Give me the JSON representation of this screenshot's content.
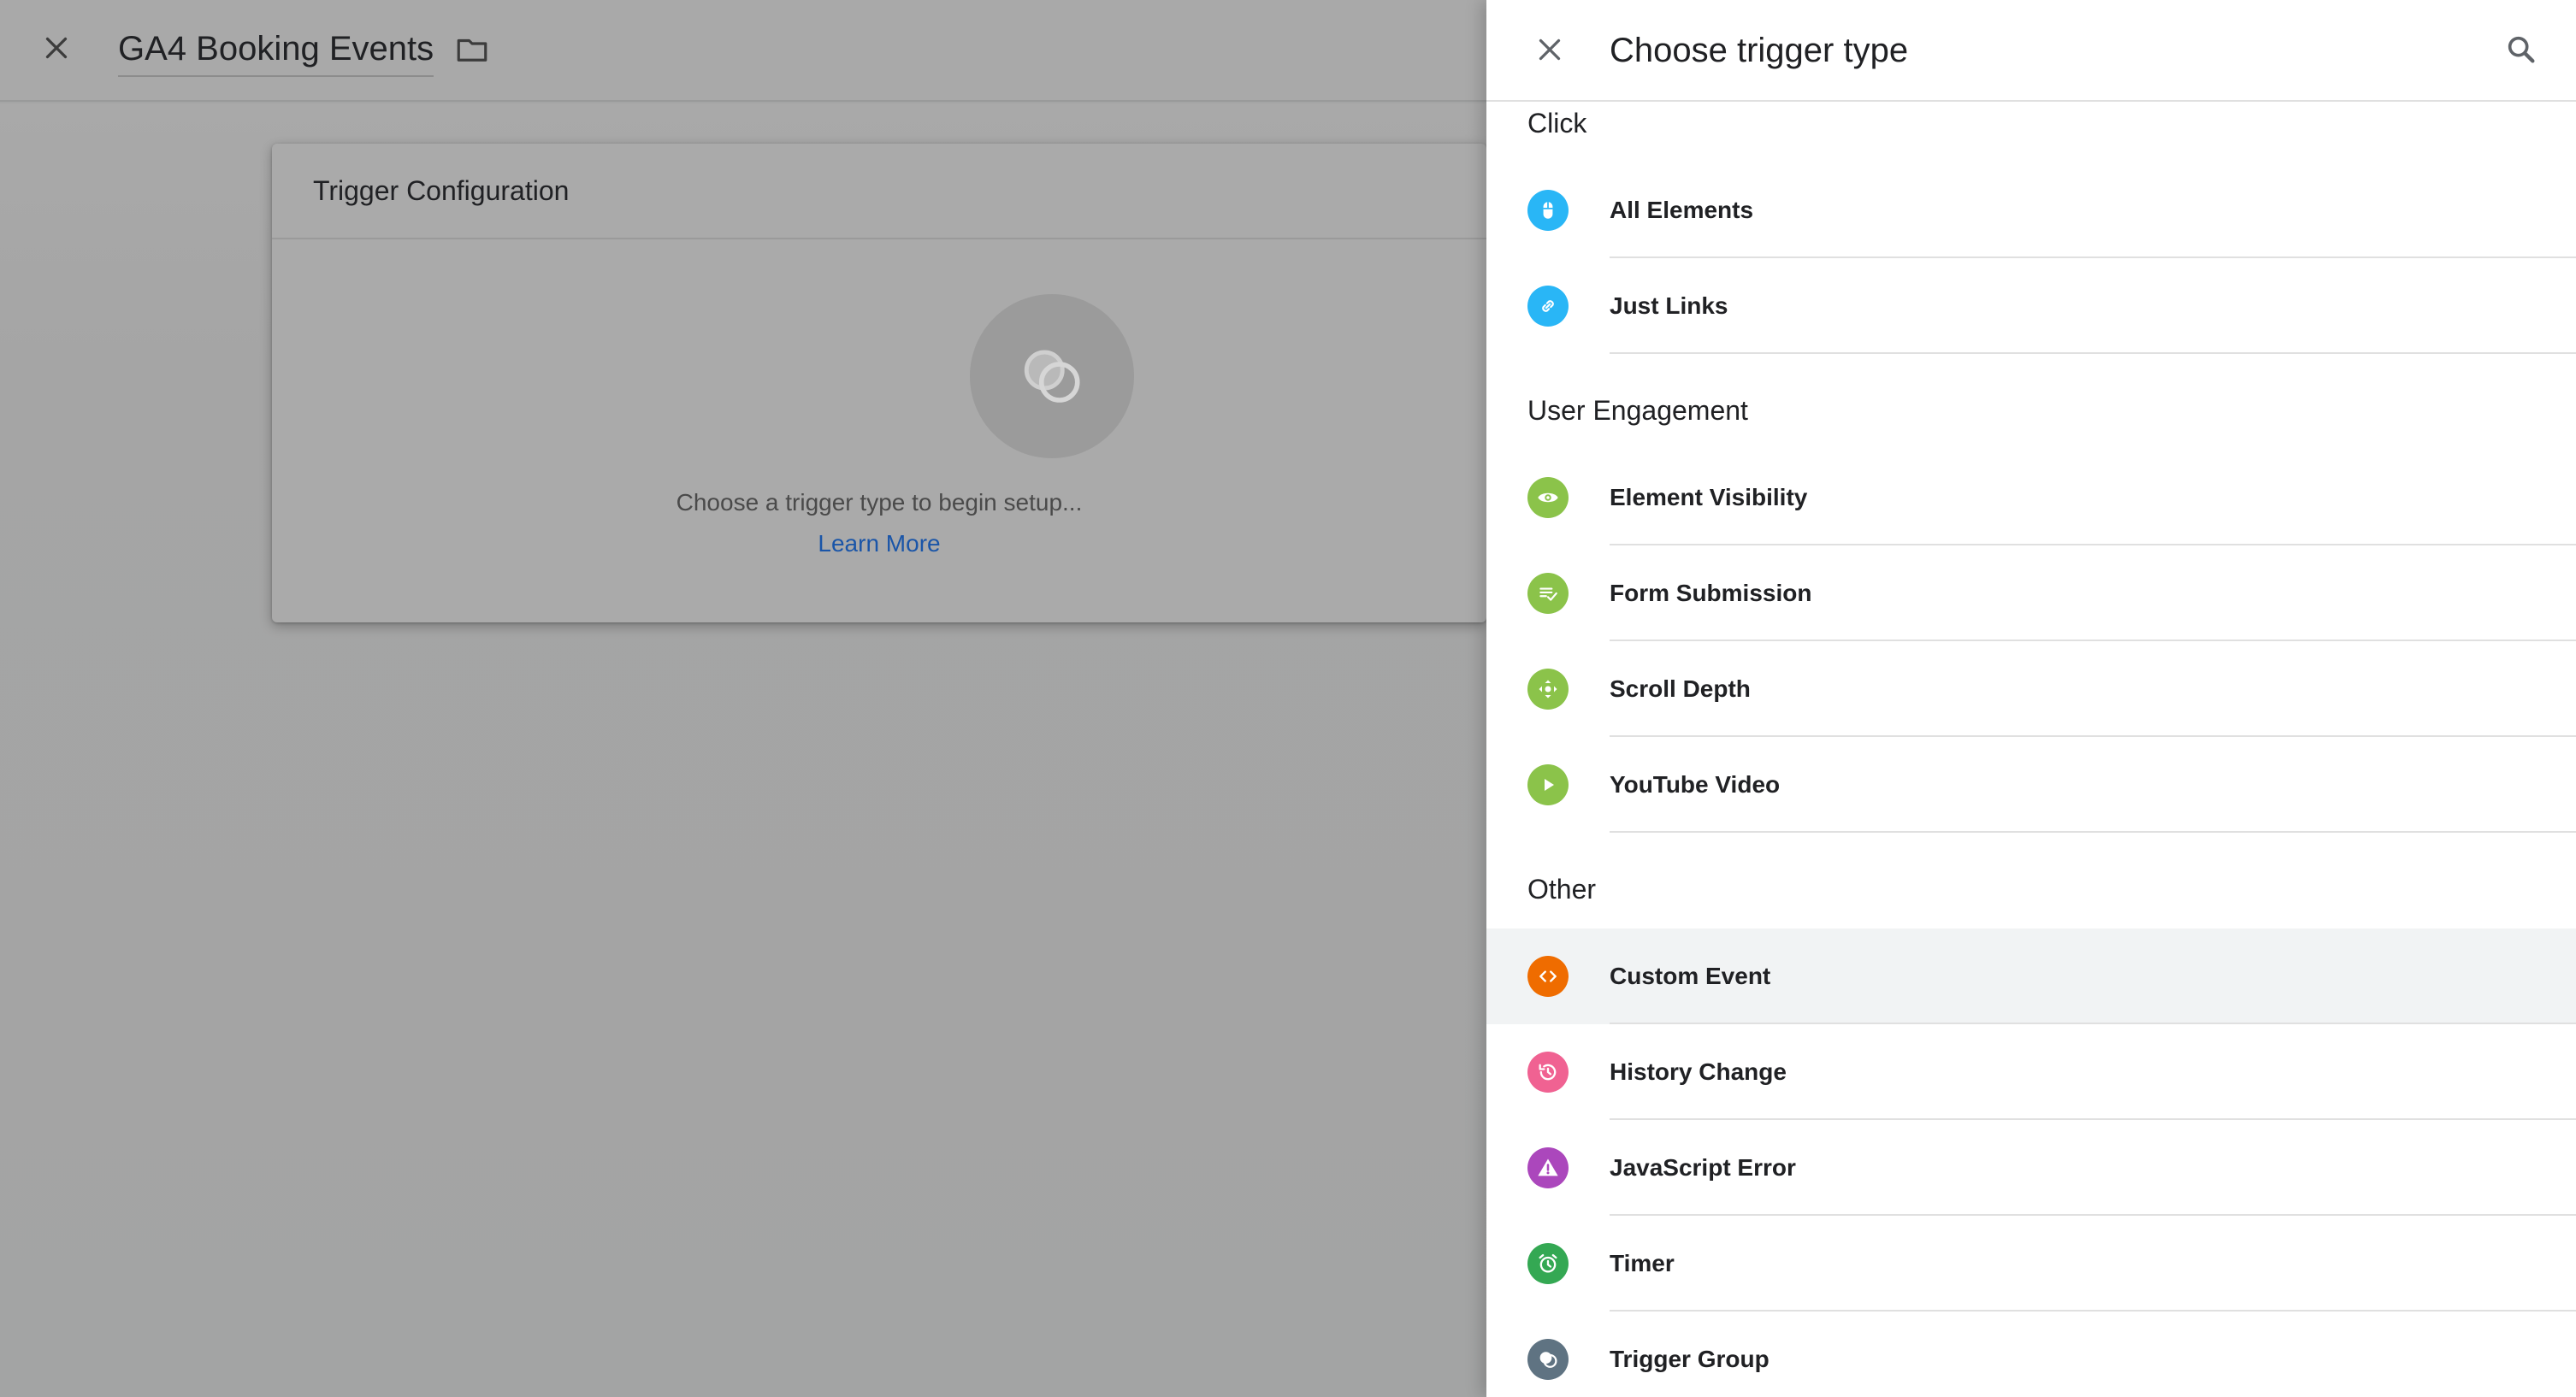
{
  "app": {
    "title": "GA4 Booking Events"
  },
  "config_card": {
    "title": "Trigger Configuration",
    "placeholder_text": "Choose a trigger type to begin setup...",
    "learn_more": "Learn More"
  },
  "drawer": {
    "title": "Choose trigger type",
    "sections": [
      {
        "label": "Click",
        "items": [
          {
            "label": "All Elements",
            "icon": "mouse-icon",
            "color": "#29b6f6"
          },
          {
            "label": "Just Links",
            "icon": "link-icon",
            "color": "#29b6f6"
          }
        ]
      },
      {
        "label": "User Engagement",
        "items": [
          {
            "label": "Element Visibility",
            "icon": "eye-icon",
            "color": "#8bc34a"
          },
          {
            "label": "Form Submission",
            "icon": "form-check-icon",
            "color": "#8bc34a"
          },
          {
            "label": "Scroll Depth",
            "icon": "scroll-move-icon",
            "color": "#8bc34a"
          },
          {
            "label": "YouTube Video",
            "icon": "play-icon",
            "color": "#8bc34a"
          }
        ]
      },
      {
        "label": "Other",
        "items": [
          {
            "label": "Custom Event",
            "icon": "code-icon",
            "color": "#ef6c00"
          },
          {
            "label": "History Change",
            "icon": "history-icon",
            "color": "#f06292"
          },
          {
            "label": "JavaScript Error",
            "icon": "warning-icon",
            "color": "#ab47bc"
          },
          {
            "label": "Timer",
            "icon": "alarm-icon",
            "color": "#34a853"
          },
          {
            "label": "Trigger Group",
            "icon": "trigger-group-icon",
            "color": "#5f7382"
          }
        ]
      }
    ]
  },
  "colors": {
    "highlight_row": "#f1f3f4",
    "link": "#1a55a8"
  }
}
